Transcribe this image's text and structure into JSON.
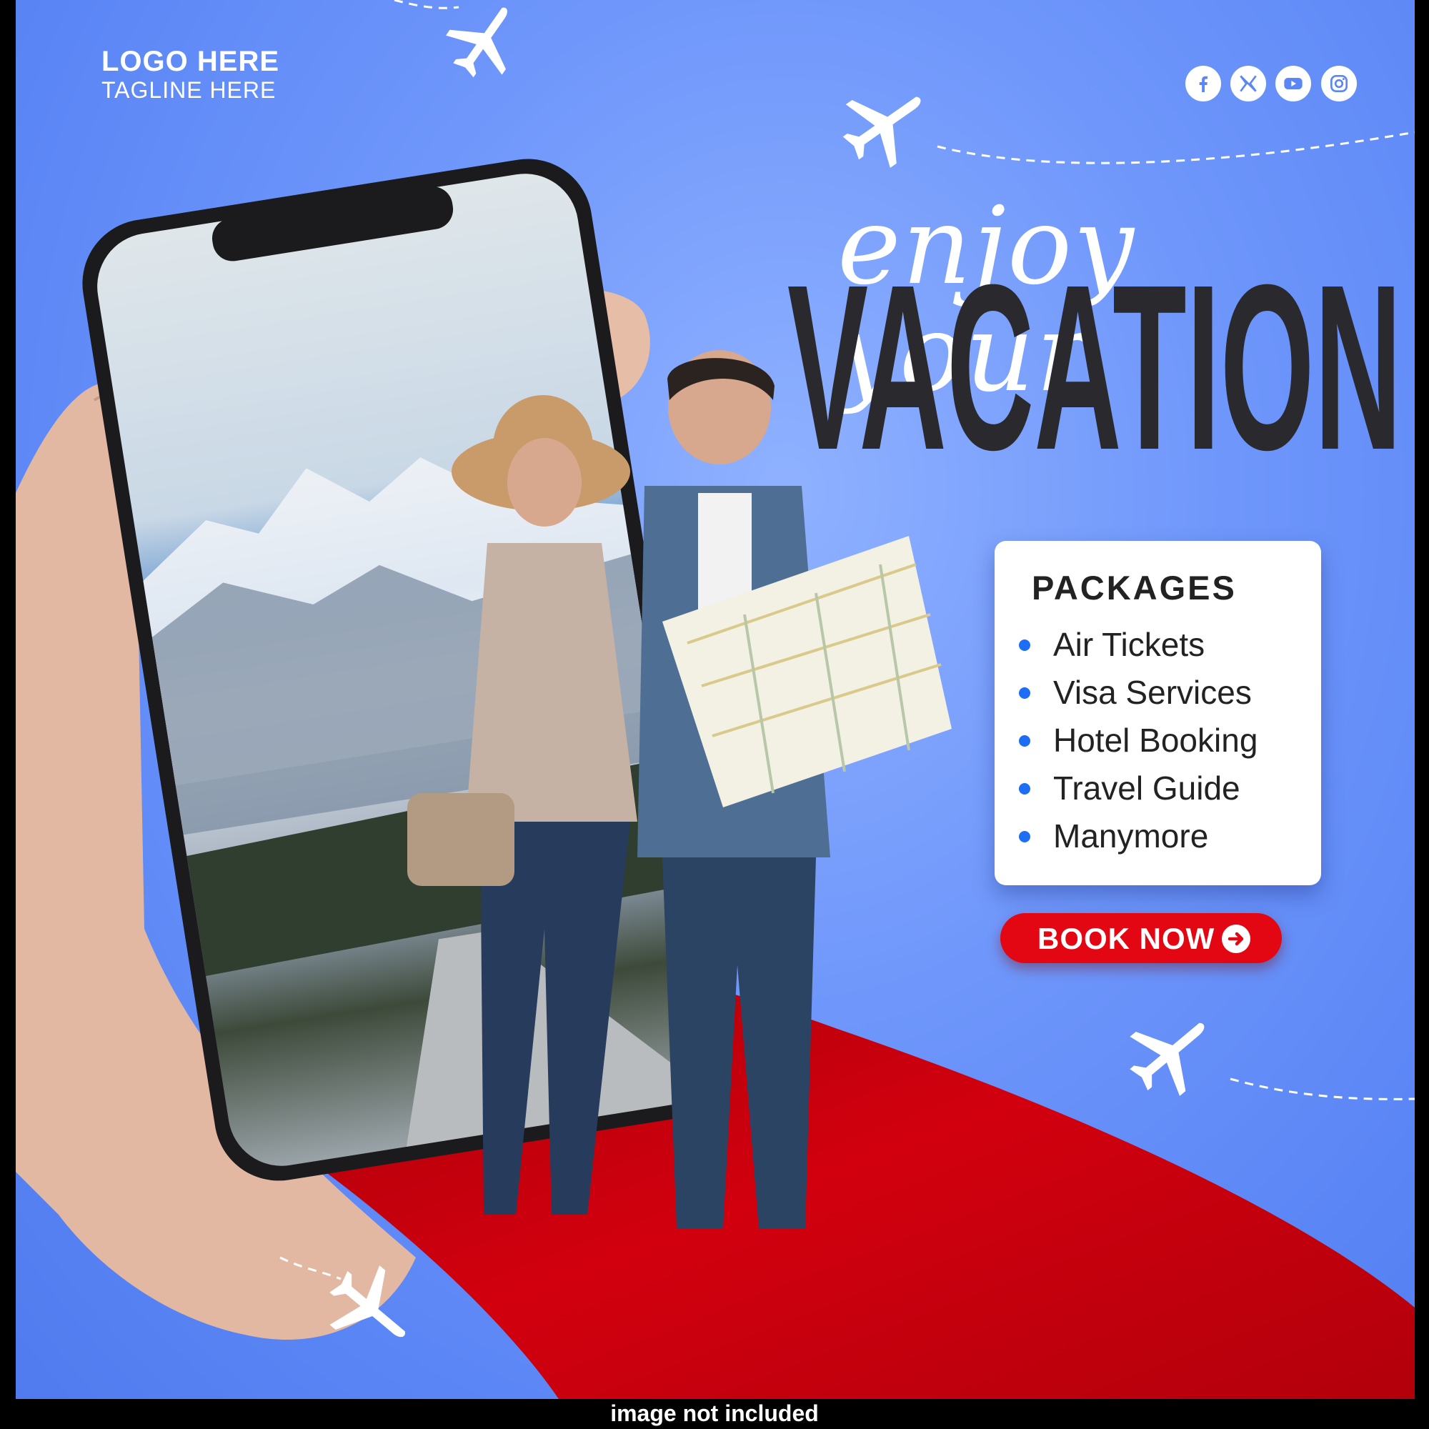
{
  "brand": {
    "logo": "LOGO HERE",
    "tagline": "TAGLINE HERE"
  },
  "social_icons": [
    "facebook-icon",
    "x-icon",
    "youtube-icon",
    "instagram-icon"
  ],
  "headline": {
    "script": "enjoy your",
    "main": "VACATION"
  },
  "packages": {
    "title": "PACKAGES",
    "items": [
      "Air Tickets",
      "Visa Services",
      "Hotel Booking",
      "Travel Guide",
      "Manymore"
    ]
  },
  "cta": {
    "label": "BOOK NOW"
  },
  "footer_note": "image not included",
  "colors": {
    "background": "#6f97fb",
    "accent_red": "#e30613",
    "bullet": "#1e6df5",
    "headline_text": "#2a2a2e"
  }
}
